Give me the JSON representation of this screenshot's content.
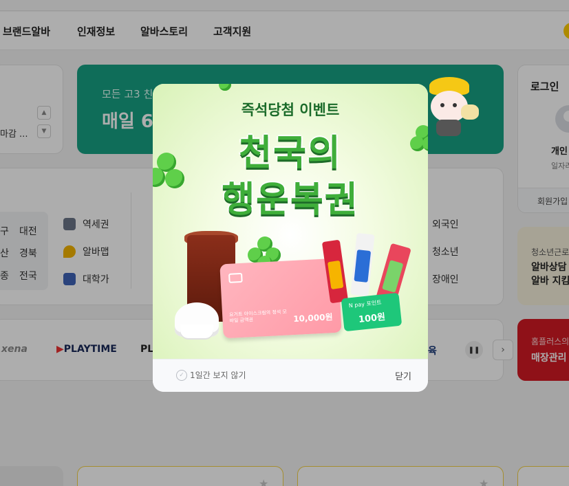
{
  "gnb": {
    "items": [
      "브랜드알바",
      "인재정보",
      "알바스토리",
      "고객지원"
    ]
  },
  "ticker": {
    "text": "마감 ..."
  },
  "banner": {
    "subtitle": "모든 고3 친",
    "title": "매일 6"
  },
  "login": {
    "title": "로그인",
    "personal": "개인",
    "desc": "일자리",
    "signup": "회원가입"
  },
  "regions": [
    [
      "구",
      "대전"
    ],
    [
      "산",
      "경북"
    ],
    [
      "종",
      "전국"
    ]
  ],
  "menu": [
    {
      "label": "역세권",
      "icon": "subway-icon"
    },
    {
      "label": "알바맵",
      "icon": "map-pin-icon"
    },
    {
      "label": "대학가",
      "icon": "university-icon"
    }
  ],
  "right_categories": [
    "외국인",
    "청소년",
    "장애인"
  ],
  "youth": {
    "sub": "청소년근로",
    "line1": "알바상담",
    "line2": "알바 지킴"
  },
  "brands": {
    "left": "xena",
    "playtime": "PLAYTIME",
    "partial": "PLE",
    "edu": "육"
  },
  "homeplus": {
    "sub": "홈플러스의",
    "title": "매장관리"
  },
  "modal": {
    "subtitle": "즉석당첨 이벤트",
    "title_line1": "천국의",
    "title_line2": "행운복권",
    "giftcard_label": "요거트 아이스크림의 정석 모바일 금액권",
    "giftcard_amount": "10,000원",
    "npay_label": "N pay 포인트",
    "npay_amount": "100원",
    "no_show_label": "1일간 보지 않기",
    "close_label": "닫기"
  },
  "colors": {
    "banner": "#17a184",
    "homeplus": "#d31a24",
    "npay": "#1ec77a",
    "title_green": "#3fae3a"
  }
}
